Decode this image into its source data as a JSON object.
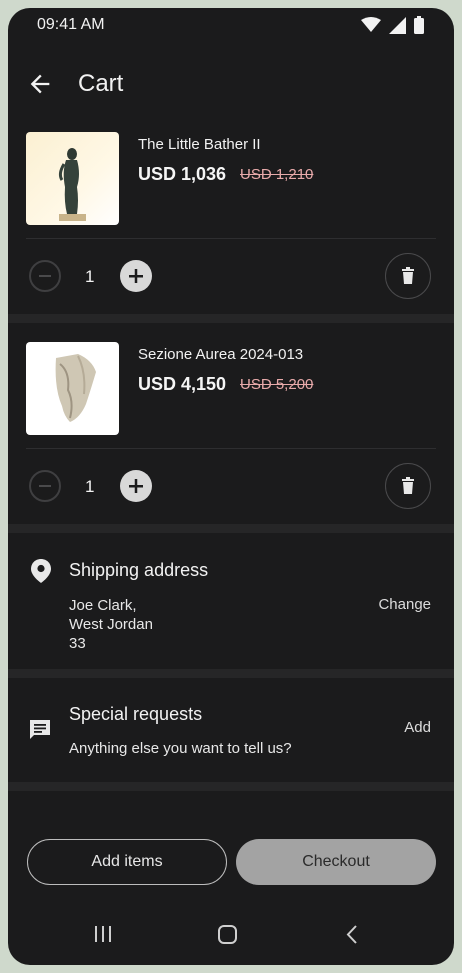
{
  "status": {
    "time": "09:41 AM"
  },
  "header": {
    "title": "Cart"
  },
  "items": [
    {
      "name": "The Little Bather II",
      "price": "USD 1,036",
      "old_price": "USD 1,210",
      "quantity": "1"
    },
    {
      "name": "Sezione Aurea 2024-013",
      "price": "USD 4,150",
      "old_price": "USD 5,200",
      "quantity": "1"
    }
  ],
  "shipping": {
    "title": "Shipping address",
    "line1": "Joe Clark,",
    "line2": "West Jordan",
    "line3": "33",
    "action": "Change"
  },
  "requests": {
    "title": "Special requests",
    "subtitle": "Anything else you want to tell us?",
    "action": "Add"
  },
  "footer": {
    "add_items": "Add items",
    "checkout": "Checkout"
  },
  "icons": {
    "back": "arrow-back-icon",
    "location": "location-pin-icon",
    "message": "message-icon",
    "trash": "trash-icon",
    "minus": "minus-circle-icon",
    "plus": "plus-circle-icon"
  }
}
